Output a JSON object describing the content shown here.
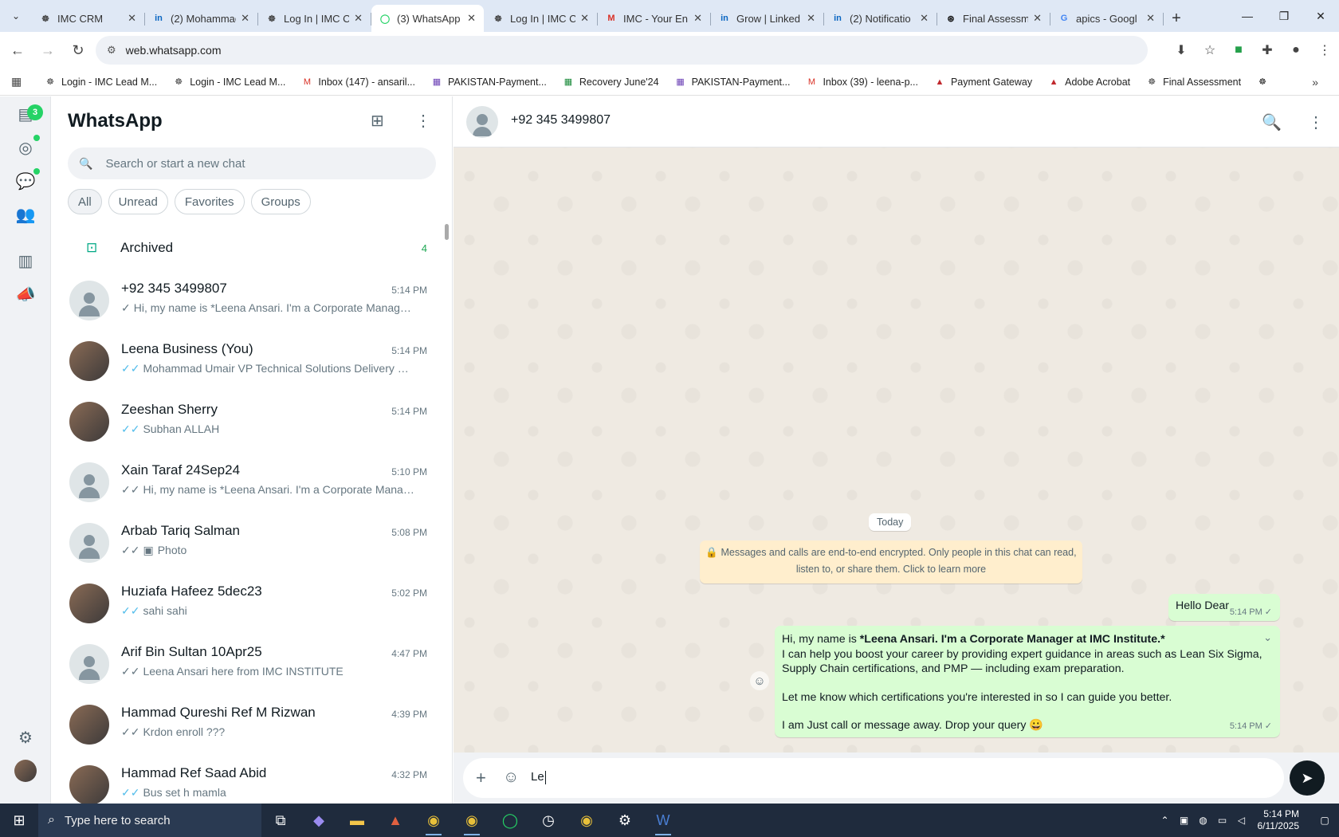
{
  "browser": {
    "tabs": [
      {
        "title": "IMC CRM",
        "icon": "imc-icon"
      },
      {
        "title": "(2) Mohammad",
        "icon": "linkedin-icon"
      },
      {
        "title": "Log In | IMC C",
        "icon": "imc-icon"
      },
      {
        "title": "(3) WhatsApp",
        "icon": "whatsapp-icon",
        "active": true
      },
      {
        "title": "Log In | IMC C",
        "icon": "imc-icon"
      },
      {
        "title": "IMC - Your En",
        "icon": "gmail-icon"
      },
      {
        "title": "Grow | Linked",
        "icon": "linkedin-icon"
      },
      {
        "title": "(2) Notificatio",
        "icon": "linkedin-icon"
      },
      {
        "title": "Final Assessm",
        "icon": "openai-icon"
      },
      {
        "title": "apics - Googl",
        "icon": "google-icon"
      }
    ],
    "url": "web.whatsapp.com",
    "bookmarks": [
      "Login - IMC Lead M...",
      "Login - IMC Lead M...",
      "Inbox (147) - ansaril...",
      "PAKISTAN-Payment...",
      "Recovery June'24",
      "PAKISTAN-Payment...",
      "Inbox (39) - leena-p...",
      "Payment Gateway",
      "Adobe Acrobat",
      "Final Assessment"
    ]
  },
  "rail": {
    "badge": "3"
  },
  "panel": {
    "title": "WhatsApp",
    "search_placeholder": "Search or start a new chat",
    "filters": [
      "All",
      "Unread",
      "Favorites",
      "Groups"
    ],
    "archived_label": "Archived",
    "archived_count": "4"
  },
  "chats": [
    {
      "name": "+92 345 3499807",
      "time": "5:14 PM",
      "preview": "Hi, my name is *Leena Ansari. I'm a Corporate Manager ...",
      "tick": "single",
      "avatar": "default"
    },
    {
      "name": "Leena Business (You)",
      "time": "5:14 PM",
      "preview": "Mohammad Umair VP Technical Solutions Delivery Mee...",
      "tick": "blue",
      "avatar": "photo"
    },
    {
      "name": "Zeeshan Sherry",
      "time": "5:14 PM",
      "preview": "Subhan ALLAH",
      "tick": "blue",
      "avatar": "photo"
    },
    {
      "name": "Xain Taraf 24Sep24",
      "time": "5:10 PM",
      "preview": "Hi, my name is *Leena Ansari. I'm a Corporate Manager ...",
      "tick": "double",
      "avatar": "default"
    },
    {
      "name": "Arbab Tariq Salman",
      "time": "5:08 PM",
      "preview": "Photo",
      "tick": "double",
      "avatar": "default",
      "photo_icon": true
    },
    {
      "name": "Huziafa Hafeez 5dec23",
      "time": "5:02 PM",
      "preview": "sahi sahi",
      "tick": "blue",
      "avatar": "photo"
    },
    {
      "name": "Arif Bin Sultan 10Apr25",
      "time": "4:47 PM",
      "preview": "Leena Ansari here from IMC INSTITUTE",
      "tick": "double",
      "avatar": "default"
    },
    {
      "name": "Hammad Qureshi Ref M Rizwan",
      "time": "4:39 PM",
      "preview": "Krdon enroll ???",
      "tick": "double",
      "avatar": "photo"
    },
    {
      "name": "Hammad Ref Saad Abid",
      "time": "4:32 PM",
      "preview": "Bus set h mamla",
      "tick": "blue",
      "avatar": "photo"
    }
  ],
  "conversation": {
    "contact": "+92 345 3499807",
    "day_separator": "Today",
    "encryption_notice_1": "Messages and calls are end-to-end encrypted. Only people in this chat can read,",
    "encryption_notice_2": "listen to, or share them. Click to learn more",
    "messages": [
      {
        "text": "Hello Dear",
        "time": "5:14 PM"
      },
      {
        "line1_prefix": "Hi, my name is ",
        "line1_bold": "*Leena Ansari. I'm a Corporate Manager at IMC Institute.*",
        "line2": "I can help you boost your career by providing expert guidance in areas such as Lean Six Sigma,",
        "line3": "Supply Chain certifications, and PMP — including exam preparation.",
        "line4": "Let me know which certifications you're interested in so I can guide you better.",
        "line5": "I am Just call or message away. Drop your query 😀",
        "time": "5:14 PM"
      }
    ],
    "composer_text": "Le"
  },
  "taskbar": {
    "search_placeholder": "Type here to search",
    "time": "5:14 PM",
    "date": "6/11/2025"
  },
  "colors": {
    "accent": "#25d366",
    "outgoing_bubble": "#d9fdd3",
    "chat_bg": "#efeae2",
    "blue_tick": "#53bdeb"
  }
}
